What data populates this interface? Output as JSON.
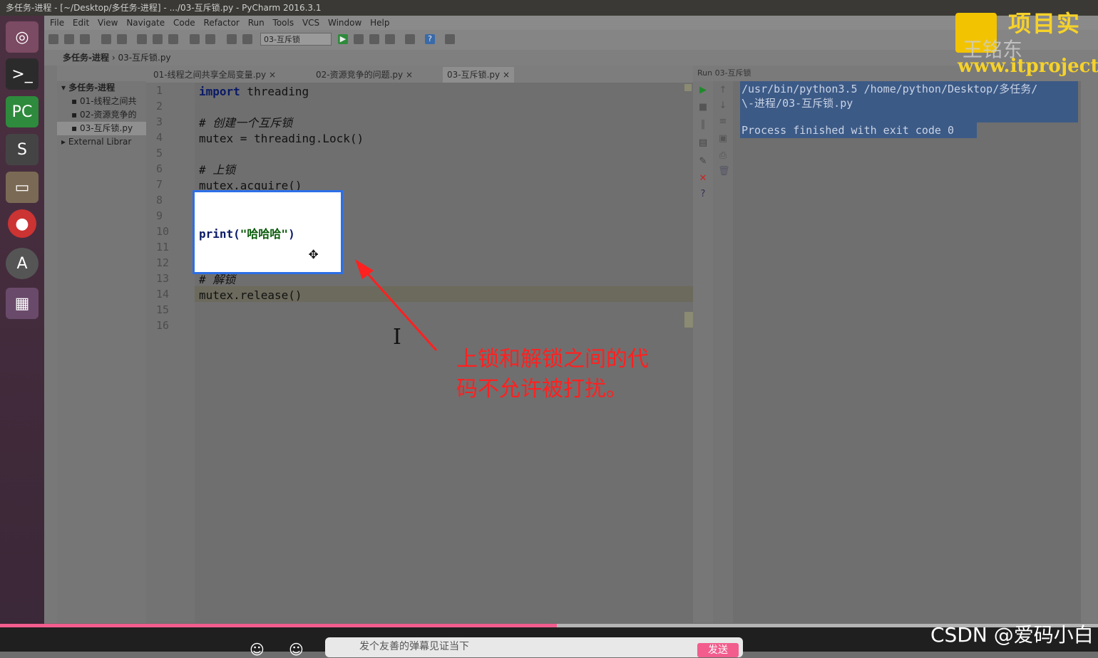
{
  "window": {
    "title": "多任务-进程 - [~/Desktop/多任务-进程] - .../03-互斥锁.py - PyCharm 2016.3.1"
  },
  "menu": [
    "File",
    "Edit",
    "View",
    "Navigate",
    "Code",
    "Refactor",
    "Run",
    "Tools",
    "VCS",
    "Window",
    "Help"
  ],
  "toolbar": {
    "run_config": "03-互斥锁"
  },
  "breadcrumb": {
    "project": "多任务-进程",
    "file": "03-互斥锁.py"
  },
  "project_tree": [
    {
      "label": "多任务-进程",
      "selected": false
    },
    {
      "label": "01-线程之间共",
      "selected": false
    },
    {
      "label": "02-资源竞争的",
      "selected": false
    },
    {
      "label": "03-互斥锁.py",
      "selected": true
    },
    {
      "label": "External Librar",
      "selected": false
    }
  ],
  "tabs": [
    {
      "label": "01-线程之间共享全局变量.py ×",
      "active": false
    },
    {
      "label": "02-资源竞争的问题.py ×",
      "active": false
    },
    {
      "label": "03-互斥锁.py ×",
      "active": true
    }
  ],
  "line_numbers": [
    "1",
    "2",
    "3",
    "4",
    "5",
    "6",
    "7",
    "8",
    "9",
    "10",
    "11",
    "12",
    "13",
    "14",
    "15",
    "16"
  ],
  "code": {
    "l1_kw": "import",
    "l1_rest": " threading",
    "l3": "# 创建一个互斥锁",
    "l4": "mutex = threading.Lock()",
    "l6": "# 上锁",
    "l7": "mutex.acquire()",
    "l13": "# 解锁",
    "l14": "mutex.release()"
  },
  "popup": {
    "code_prefix": "print(",
    "code_string": "\"哈哈哈\"",
    "code_suffix": ")"
  },
  "run_panel": {
    "header": "Run  03-互斥锁",
    "line1": "/usr/bin/python3.5 /home/python/Desktop/多任务/",
    "line2": "\\-进程/03-互斥锁.py",
    "line3": "Process finished with exit code 0"
  },
  "annotation": {
    "text_line1": "上锁和解锁之间的代",
    "text_line2": "码不允许被打扰。",
    "color": "#ff2020"
  },
  "watermark": {
    "title": "项目实",
    "sub": "王铭东",
    "url": "www.itproject"
  },
  "player": {
    "progress": 0.507,
    "credit": "CSDN @爱码小白",
    "danmu_placeholder": "发个友善的弹幕见证当下",
    "send_label": "发送"
  }
}
